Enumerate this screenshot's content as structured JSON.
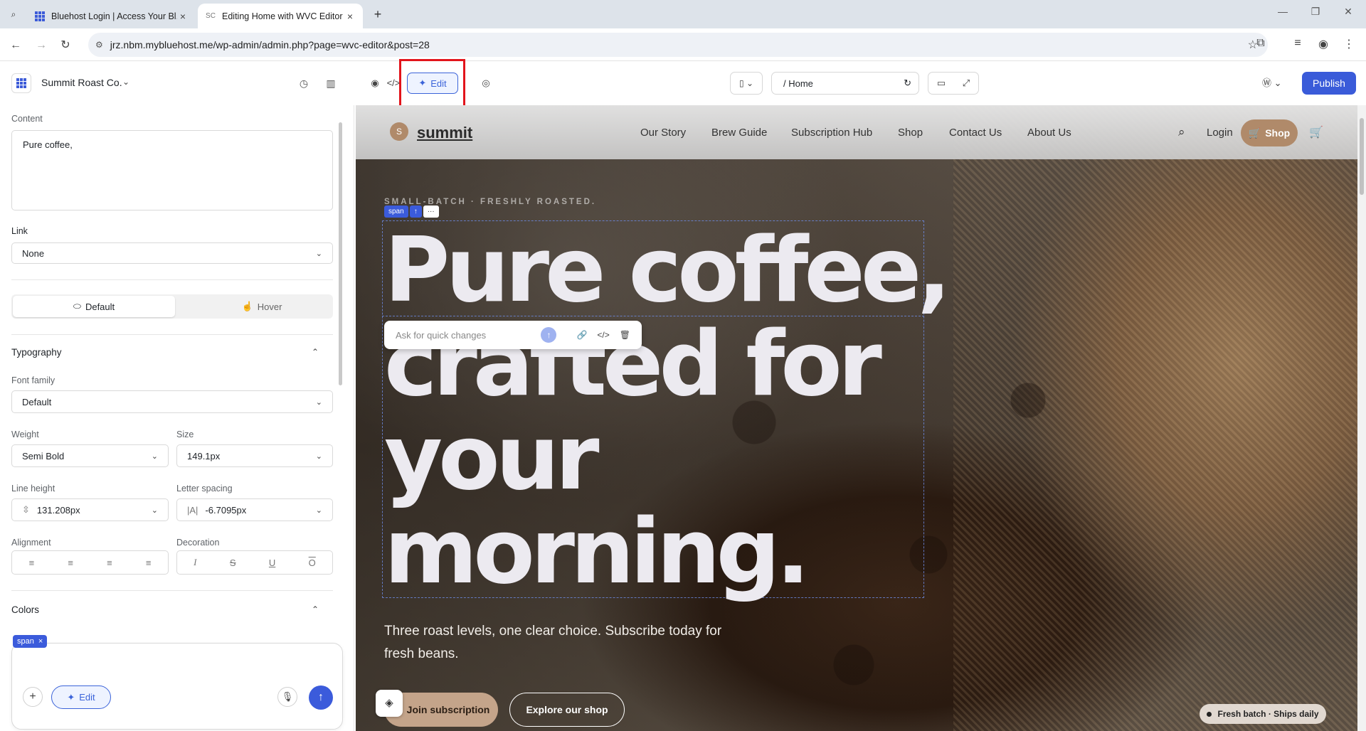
{
  "browser": {
    "tabs": [
      {
        "title": "Bluehost Login | Access Your Bl...",
        "active": false
      },
      {
        "title": "Editing Home with WVC Editor",
        "active": true
      }
    ],
    "url": "jrz.nbm.mybluehost.me/wp-admin/admin.php?page=wvc-editor&post=28"
  },
  "editor": {
    "site_name": "Summit Roast Co.",
    "edit_label": "Edit",
    "route": "/ Home",
    "publish_label": "Publish"
  },
  "panel": {
    "content_label": "Content",
    "content_value": "Pure coffee,",
    "link_label": "Link",
    "link_value": "None",
    "state_default": "Default",
    "state_hover": "Hover",
    "typography_title": "Typography",
    "font_family_label": "Font family",
    "font_family_value": "Default",
    "weight_label": "Weight",
    "weight_value": "Semi Bold",
    "size_label": "Size",
    "size_value": "149.1px",
    "line_height_label": "Line height",
    "line_height_value": "131.208px",
    "letter_spacing_label": "Letter spacing",
    "letter_spacing_value": "-6.7095px",
    "alignment_label": "Alignment",
    "decoration_label": "Decoration",
    "colors_title": "Colors",
    "chip_label": "span",
    "chat_edit_label": "Edit"
  },
  "site": {
    "logo_letter": "S",
    "brand": "summit",
    "nav": [
      "Our Story",
      "Brew Guide",
      "Subscription Hub",
      "Shop",
      "Contact Us",
      "About Us"
    ],
    "login": "Login",
    "shop_btn": "Shop",
    "eyebrow": "SMALL-BATCH · FRESHLY ROASTED.",
    "headline": "Pure coffee, crafted for your morning.",
    "quick_placeholder": "Ask for quick changes",
    "subtitle": "Three roast levels, one clear choice. Subscribe today for fresh beans.",
    "cta_primary": "Join subscription",
    "cta_secondary": "Explore our shop",
    "badge": "Fresh batch · Ships daily",
    "sel_tag": "span"
  },
  "colors": {
    "accent": "#3b5bdb",
    "highlight": "#e2141b",
    "shop_button": "#b08a6a"
  }
}
